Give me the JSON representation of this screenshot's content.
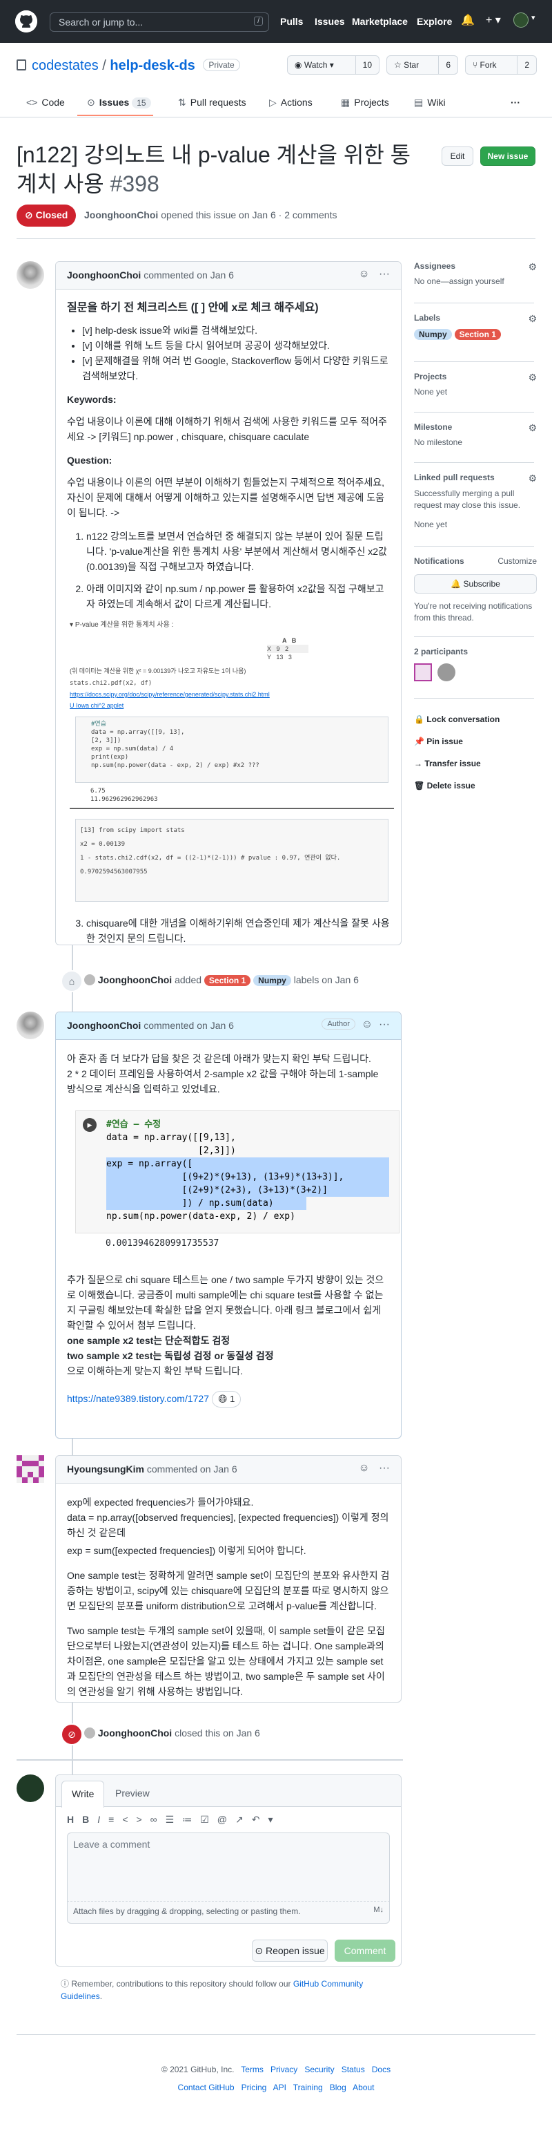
{
  "header": {
    "search_placeholder": "Search or jump to...",
    "slash": "/",
    "nav": [
      "Pulls",
      "Issues",
      "Marketplace",
      "Explore"
    ]
  },
  "repo": {
    "owner": "codestates",
    "sep": "/",
    "name": "help-desk-ds",
    "visibility": "Private",
    "watch_label": "Watch",
    "watch_count": "10",
    "star_label": "Star",
    "star_count": "6",
    "fork_label": "Fork",
    "fork_count": "2"
  },
  "tabs": [
    {
      "label": "Code"
    },
    {
      "label": "Issues",
      "count": "15"
    },
    {
      "label": "Pull requests"
    },
    {
      "label": "Actions"
    },
    {
      "label": "Projects"
    },
    {
      "label": "Wiki"
    }
  ],
  "issue": {
    "title": "[n122] 강의노트 내 p-value 계산을 위한 통계치 사용",
    "number": "#398",
    "edit_label": "Edit",
    "new_issue_label": "New issue",
    "state": "Closed",
    "author": "JoonghoonChoi",
    "meta_rest": "opened this issue on Jan 6 · 2 comments"
  },
  "comment1": {
    "author": "JoonghoonChoi",
    "when": "commented on Jan 6",
    "heading": "질문을 하기 전 체크리스트 ([ ] 안에 x로 체크 해주세요)",
    "checklist": [
      "[v] help-desk issue와 wiki를 검색해보았다.",
      "[v] 이해를 위해 노트 등을 다시 읽어보며 공공이 생각해보았다.",
      "[v] 문제해결을 위해 여러 번 Google, Stackoverflow 등에서 다양한 키워드로 검색해보았다."
    ],
    "keywords_title": "Keywords:",
    "keywords_text": "수업 내용이나 이론에 대해 이해하기 위해서 검색에 사용한 키워드를 모두 적어주세요 -> [키워드] np.power , chisquare, chisquare caculate",
    "question_title": "Question:",
    "question_text": "수업 내용이나 이론의 어떤 부분이 이해하기 힘들었는지 구체적으로 적어주세요, 자신이 문제에 대해서 어떻게 이해하고 있는지를 설명해주시면 답변 제공에 도움이 됩니다. ->",
    "items": [
      "n122 강의노트를 보면서 연습하던 중 해결되지 않는 부분이 있어 질문 드립니다. 'p-value계산을 위한 통계치 사용' 부분에서 계산해서 명시해주신 x2값(0.00139)을 직접 구해보고자 하였습니다.",
      "아래 이미지와 같이 np.sum / np.power 를 활용하여 x2값을 직접 구해보고자 하였는데 계속해서 값이 다르게 계산됩니다.",
      "chisquare에 대한 개념을 이해하기위해 연습중인데 제가 계산식을 잘못 사용한 것인지 문의 드립니다."
    ],
    "details_summary": "P-value 계산을 위한 통계치 사용 :",
    "mini_table_header": [
      "A",
      "B"
    ],
    "mini_table_rows": [
      [
        "X",
        "9",
        "2"
      ],
      [
        "Y",
        "13",
        "3"
      ]
    ],
    "mini_formula_text": "(위 데이터는 계산을 위한 χ² = 9.00139가 나오고 자유도는 1이 나옴)",
    "mini_call": "stats.chi2.pdf(x2, df)",
    "mini_link": "https://docs.scipy.org/doc/scipy/reference/generated/scipy.stats.chi2.html",
    "mini_link2": "U Iowa chi^2 applet",
    "mini_code": [
      "#연습",
      "data = np.array([[9, 13],",
      "                 [2, 3]])",
      "exp = np.sum(data) / 4",
      "print(exp)",
      "np.sum(np.power(data - exp, 2) / exp) #x2 ???"
    ],
    "mini_out": [
      "6.75",
      "11.962962962962963"
    ],
    "mini_code2": [
      "[13] from scipy import stats",
      "     x2 = 0.00139",
      "     1 - stats.chi2.cdf(x2, df = ((2-1)*(2-1))) # pvalue : 0.97, 연관이 없다.",
      "     0.9702594563007955"
    ]
  },
  "labels_event": {
    "actor": "JoonghoonChoi",
    "action": "added",
    "labels": [
      "Section 1",
      "Numpy"
    ],
    "rest": "labels on Jan 6"
  },
  "comment2": {
    "author": "JoonghoonChoi",
    "when": "commented on Jan 6",
    "role": "Author",
    "p1": "아 혼자 좀 더 보다가 답을 찾은 것 같은데 아래가 맞는지 확인 부탁 드립니다.",
    "p2": "2 * 2 데이터 프레임을 사용하여서 2-sample x2 값을 구해야 하는데 1-sample 방식으로 계산식을 입력하고 있었네요.",
    "code_comment": "#연습 — 수정",
    "code": [
      "data = np.array([[9,13],",
      "                 [2,3]])",
      "exp = np.array([",
      "              [(9+2)*(9+13), (13+9)*(13+3)],",
      "              [(2+9)*(2+3), (3+13)*(3+2)]",
      "              ]) / np.sum(data)",
      "np.sum(np.power(data-exp, 2) / exp)"
    ],
    "output": "0.0013946280991735537",
    "p3": "추가 질문으로 chi square 테스트는 one / two sample 두가지 방향이 있는 것으로 이해했습니다. 궁금증이 multi sample에는 chi square test를 사용할 수 없는지 구글링 해보았는데 확실한 답을 얻지 못했습니다. 아래 링크 블로그에서 쉽게 확인할 수 있어서 첨부 드립니다.",
    "bold1": "one sample x2 test는 단순적합도 검정",
    "bold2": "two sample x2 test는 독립성 검정 or 동질성 검정",
    "p4": "으로 이해하는게 맞는지 확인 부탁 드립니다.",
    "link": "https://nate9389.tistory.com/1727",
    "reaction": "😄",
    "reaction_count": "1"
  },
  "comment3": {
    "author": "HyoungsungKim",
    "when": "commented on Jan 6",
    "p1": "exp에 expected frequencies가 들어가야돼요.",
    "p2": "data = np.array([observed frequencies], [expected frequencies]) 이렇게 정의하신 것 같은데",
    "p3": "exp = sum([expected frequencies]) 이렇게 되어야 합니다.",
    "p4": "One sample test는 정확하게 알려면 sample set이 모집단의 분포와 유사한지 검증하는 방법이고, scipy에 있는 chisquare에 모집단의 분포를 따로 명시하지 않으면 모집단의 분포를 uniform distribution으로 고려해서 p-value를 계산합니다.",
    "p5": "Two sample test는 두개의 sample set이 있을때, 이 sample set들이 같은 모집단으로부터 나왔는지(연관성이 있는지)를 테스트 하는 겁니다. One sample과의 차이점은, one sample은 모집단을 알고 있는 상태에서 가지고 있는 sample set과 모집단의 연관성을 테스트 하는 방법이고, two sample은 두 sample set 사이의 연관성을 알기 위해 사용하는 방법입니다."
  },
  "close_event": {
    "actor": "JoonghoonChoi",
    "rest": "closed this on Jan 6"
  },
  "editor": {
    "tab_write": "Write",
    "tab_preview": "Preview",
    "placeholder": "Leave a comment",
    "attach": "Attach files by dragging & dropping, selecting or pasting them.",
    "reopen": "Reopen issue",
    "comment": "Comment",
    "tip": "Remember, contributions to this repository should follow our",
    "tip_link": "GitHub Community Guidelines",
    "tip_end": "."
  },
  "sidebar": {
    "assignees_title": "Assignees",
    "assignees_text": "No one—assign yourself",
    "labels_title": "Labels",
    "labels": [
      "Numpy",
      "Section 1"
    ],
    "projects_title": "Projects",
    "projects_text": "None yet",
    "milestone_title": "Milestone",
    "milestone_text": "No milestone",
    "linked_title": "Linked pull requests",
    "linked_text": "Successfully merging a pull request may close this issue.",
    "linked_none": "None yet",
    "notif_title": "Notifications",
    "notif_customize": "Customize",
    "subscribe": "Subscribe",
    "notif_text": "You're not receiving notifications from this thread.",
    "participants": "2 participants",
    "lock": "Lock conversation",
    "pin": "Pin issue",
    "transfer": "Transfer issue",
    "delete": "Delete issue"
  },
  "footer": {
    "copyright": "© 2021 GitHub, Inc.",
    "row1": [
      "Terms",
      "Privacy",
      "Security",
      "Status",
      "Docs"
    ],
    "row2": [
      "Contact GitHub",
      "Pricing",
      "API",
      "Training",
      "Blog",
      "About"
    ]
  },
  "colors": {
    "closed_red": "#cf222e",
    "green": "#2da44e",
    "numpy_label": "#c5def5",
    "section_label": "#e4564a"
  }
}
